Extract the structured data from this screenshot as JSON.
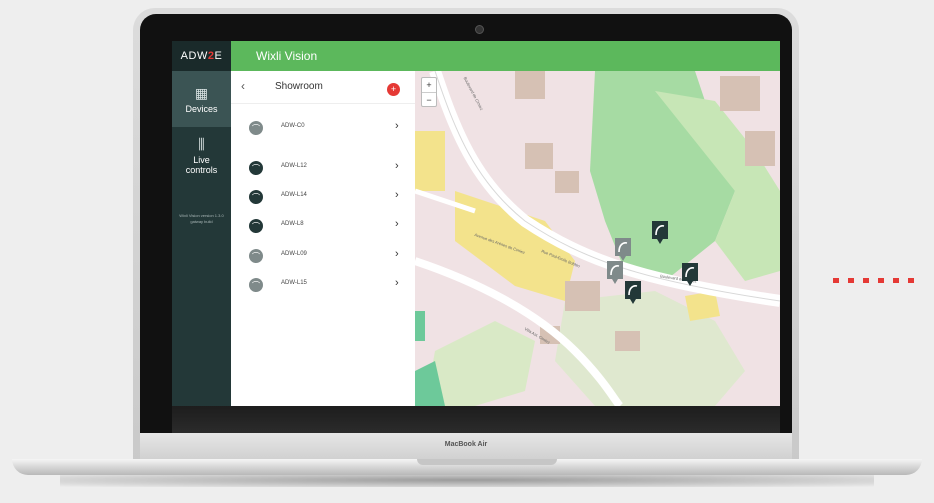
{
  "laptop": {
    "brand": "MacBook Air"
  },
  "app": {
    "logo_left": "ADW",
    "logo_mid": "2",
    "logo_right": "E",
    "title": "Wixli Vision"
  },
  "sidebar": {
    "items": [
      {
        "label": "Devices",
        "icon": "building-icon",
        "active": true
      },
      {
        "label": "Live controls",
        "icon": "sliders-icon",
        "active": false
      }
    ],
    "version": "Wixli Vision version 1.3.0 gatway build"
  },
  "panel": {
    "room": "Showroom",
    "back": "‹",
    "add": "+",
    "devices": [
      {
        "name": "ADW-C0",
        "icon": "gray"
      },
      {
        "name": "ADW-L12",
        "icon": "dark"
      },
      {
        "name": "ADW-L14",
        "icon": "dark"
      },
      {
        "name": "ADW-L8",
        "icon": "dark"
      },
      {
        "name": "ADW-L09",
        "icon": "gray"
      },
      {
        "name": "ADW-L15",
        "icon": "gray"
      }
    ]
  },
  "map": {
    "zoom_in": "+",
    "zoom_out": "−",
    "streets": [
      "Boulevard de Cimiez",
      "Avenue des Arènes de Cimiez",
      "Boulevard de Cimiez",
      "Villa Ast. Cimiez",
      "Rue Paul-Émile Bobbio"
    ]
  },
  "colors": {
    "accent": "#5cb85c",
    "sidebar": "#233838",
    "add": "#e53935"
  }
}
